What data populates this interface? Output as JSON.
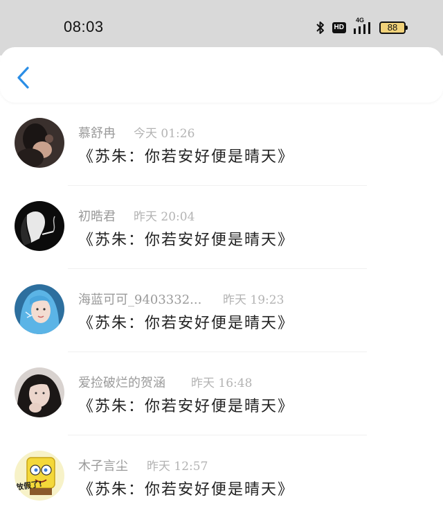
{
  "status_bar": {
    "time": "08:03",
    "network": "4G",
    "hd_badge": "HD",
    "battery": "88"
  },
  "header": {
    "back_icon": "chevron-left-icon",
    "accent_color": "#2b8ee6"
  },
  "messages": [
    {
      "name": "慕舒冉",
      "time": "今天 01:26",
      "text": "《苏朱：你若安好便是晴天》"
    },
    {
      "name": "初晧君",
      "time": "昨天 20:04",
      "text": "《苏朱：你若安好便是晴天》"
    },
    {
      "name": "海蓝可可_9403332...",
      "time": "昨天 19:23",
      "text": "《苏朱：你若安好便是晴天》"
    },
    {
      "name": "爱捡破烂的贺涵",
      "time": "昨天 16:48",
      "text": "《苏朱：你若安好便是晴天》"
    },
    {
      "name": "木子言尘",
      "time": "昨天 12:57",
      "text": "《苏朱：你若安好便是晴天》"
    }
  ],
  "sticker_text": "放假了!"
}
